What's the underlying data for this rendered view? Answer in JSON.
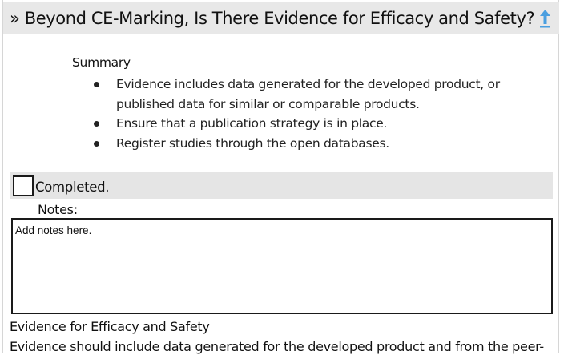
{
  "header": {
    "title": "» Beyond CE-Marking, Is There Evidence for Efficacy and Safety?",
    "up_icon": "up-arrow-icon",
    "accent_color": "#4a9fe0"
  },
  "summary": {
    "title": "Summary",
    "items": [
      "Evidence includes data generated for the developed product, or published data for similar or comparable products.",
      "Ensure that a publication strategy is in place.",
      "Register studies through the open databases."
    ]
  },
  "checklist": {
    "completed_label": "Completed.",
    "checked": false
  },
  "notes": {
    "label": "Notes:",
    "placeholder": "Add notes here."
  },
  "section": {
    "title": "Evidence for Efficacy and Safety",
    "body": "Evidence should include data generated for the developed product and from the peer-"
  }
}
